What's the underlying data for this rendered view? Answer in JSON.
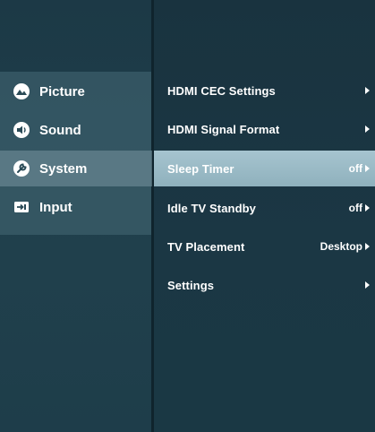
{
  "left_menu": {
    "items": [
      {
        "label": "Picture",
        "icon": "picture-icon"
      },
      {
        "label": "Sound",
        "icon": "sound-icon"
      },
      {
        "label": "System",
        "icon": "system-icon"
      },
      {
        "label": "Input",
        "icon": "input-icon"
      }
    ],
    "selected": "System"
  },
  "settings": {
    "items": [
      {
        "label": "HDMI CEC Settings",
        "value": ""
      },
      {
        "label": "HDMI Signal Format",
        "value": ""
      },
      {
        "label": "Sleep Timer",
        "value": "off"
      },
      {
        "label": "Idle TV Standby",
        "value": "off"
      },
      {
        "label": "TV Placement",
        "value": "Desktop"
      },
      {
        "label": "Settings",
        "value": ""
      }
    ],
    "selected": "Sleep Timer"
  },
  "colors": {
    "highlight": "#9cbcc8",
    "background": "#1b3744",
    "text": "#ffffff"
  }
}
